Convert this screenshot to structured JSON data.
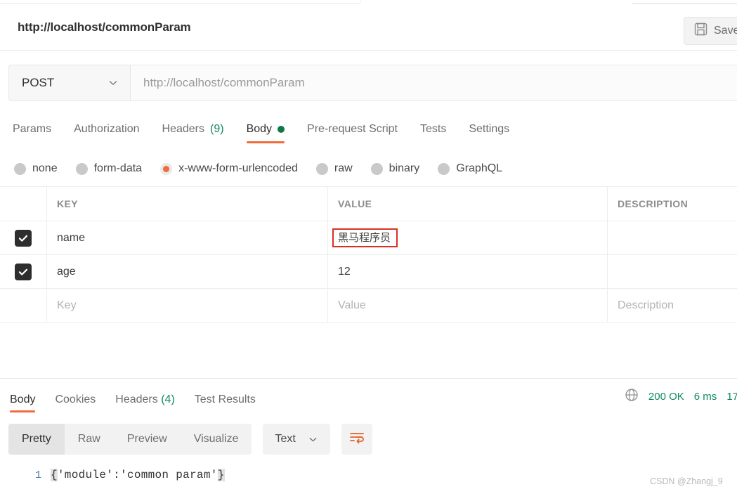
{
  "request": {
    "title": "http://localhost/commonParam",
    "save_label": "Save",
    "save_icon": "floppy-disk-icon",
    "method": "POST",
    "method_chevron": "chevron-down-icon",
    "url_value": "http://localhost/commonParam"
  },
  "request_tabs": [
    {
      "label": "Params",
      "count": "",
      "active": false,
      "dot": false
    },
    {
      "label": "Authorization",
      "count": "",
      "active": false,
      "dot": false
    },
    {
      "label": "Headers",
      "count": "(9)",
      "active": false,
      "dot": false
    },
    {
      "label": "Body",
      "count": "",
      "active": true,
      "dot": true
    },
    {
      "label": "Pre-request Script",
      "count": "",
      "active": false,
      "dot": false
    },
    {
      "label": "Tests",
      "count": "",
      "active": false,
      "dot": false
    },
    {
      "label": "Settings",
      "count": "",
      "active": false,
      "dot": false
    }
  ],
  "body_types": [
    {
      "label": "none",
      "selected": false
    },
    {
      "label": "form-data",
      "selected": false
    },
    {
      "label": "x-www-form-urlencoded",
      "selected": true
    },
    {
      "label": "raw",
      "selected": false
    },
    {
      "label": "binary",
      "selected": false
    },
    {
      "label": "GraphQL",
      "selected": false
    }
  ],
  "table": {
    "headers": {
      "key": "KEY",
      "value": "VALUE",
      "description": "DESCRIPTION"
    },
    "rows": [
      {
        "checked": true,
        "key": "name",
        "value": "黑马程序员",
        "description": "",
        "highlighted": true
      },
      {
        "checked": true,
        "key": "age",
        "value": "12",
        "description": "",
        "highlighted": false
      }
    ],
    "placeholder": {
      "key": "Key",
      "value": "Value",
      "description": "Description"
    }
  },
  "response_tabs": [
    {
      "label": "Body",
      "count": "",
      "active": true
    },
    {
      "label": "Cookies",
      "count": "",
      "active": false
    },
    {
      "label": "Headers",
      "count": "(4)",
      "active": false
    },
    {
      "label": "Test Results",
      "count": "",
      "active": false
    }
  ],
  "status": {
    "globe_icon": "globe-icon",
    "code": "200 OK",
    "time": "6 ms",
    "size": "17"
  },
  "response_toolbar": {
    "views": [
      {
        "label": "Pretty",
        "active": true
      },
      {
        "label": "Raw",
        "active": false
      },
      {
        "label": "Preview",
        "active": false
      },
      {
        "label": "Visualize",
        "active": false
      }
    ],
    "format": "Text",
    "format_chevron": "chevron-down-icon",
    "wrap_icon": "wrap-lines-icon"
  },
  "code": {
    "line_number": "1",
    "open_brace": "{",
    "content": "'module':'common param'",
    "close_brace": "}"
  },
  "watermark": "CSDN @Zhangj_9",
  "colors": {
    "accent": "#f26b3a",
    "success": "#0f8a5f",
    "highlight_border": "#d93025",
    "checkbox": "#2e2e2e"
  }
}
